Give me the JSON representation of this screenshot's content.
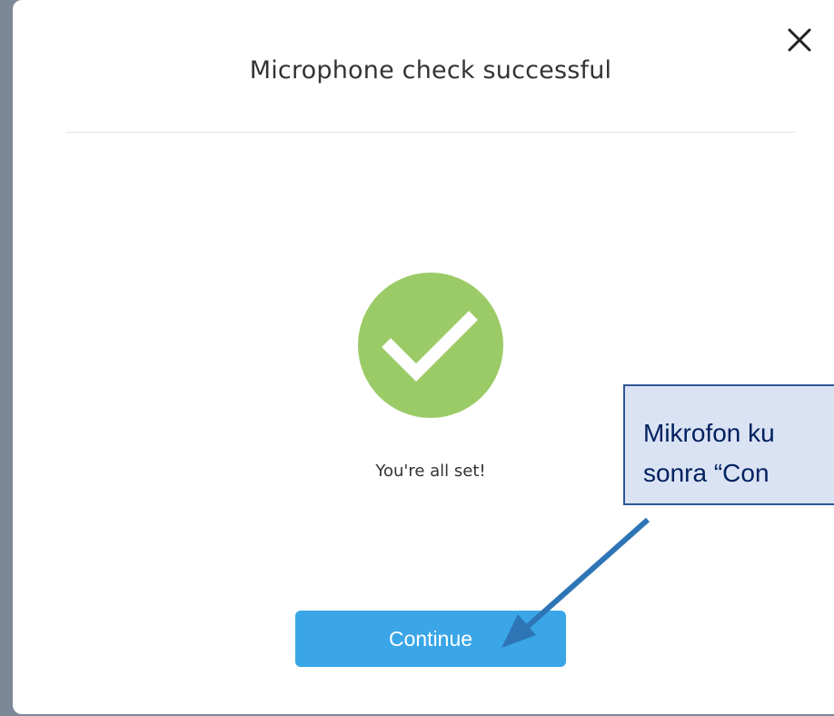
{
  "dialog": {
    "title": "Microphone check successful",
    "close_icon": "close-icon",
    "status_icon": "checkmark-circle-icon",
    "status_text": "You're all set!",
    "continue_label": "Continue"
  },
  "annotation": {
    "line1": "Mikrofon ku",
    "line2": "sonra “Con"
  },
  "colors": {
    "backdrop": "#7c8797",
    "success_green": "#9bcb67",
    "button_blue": "#3aa6e8",
    "callout_fill": "#dae3f3",
    "callout_border": "#2f5597",
    "arrow_blue": "#2e75b6"
  }
}
